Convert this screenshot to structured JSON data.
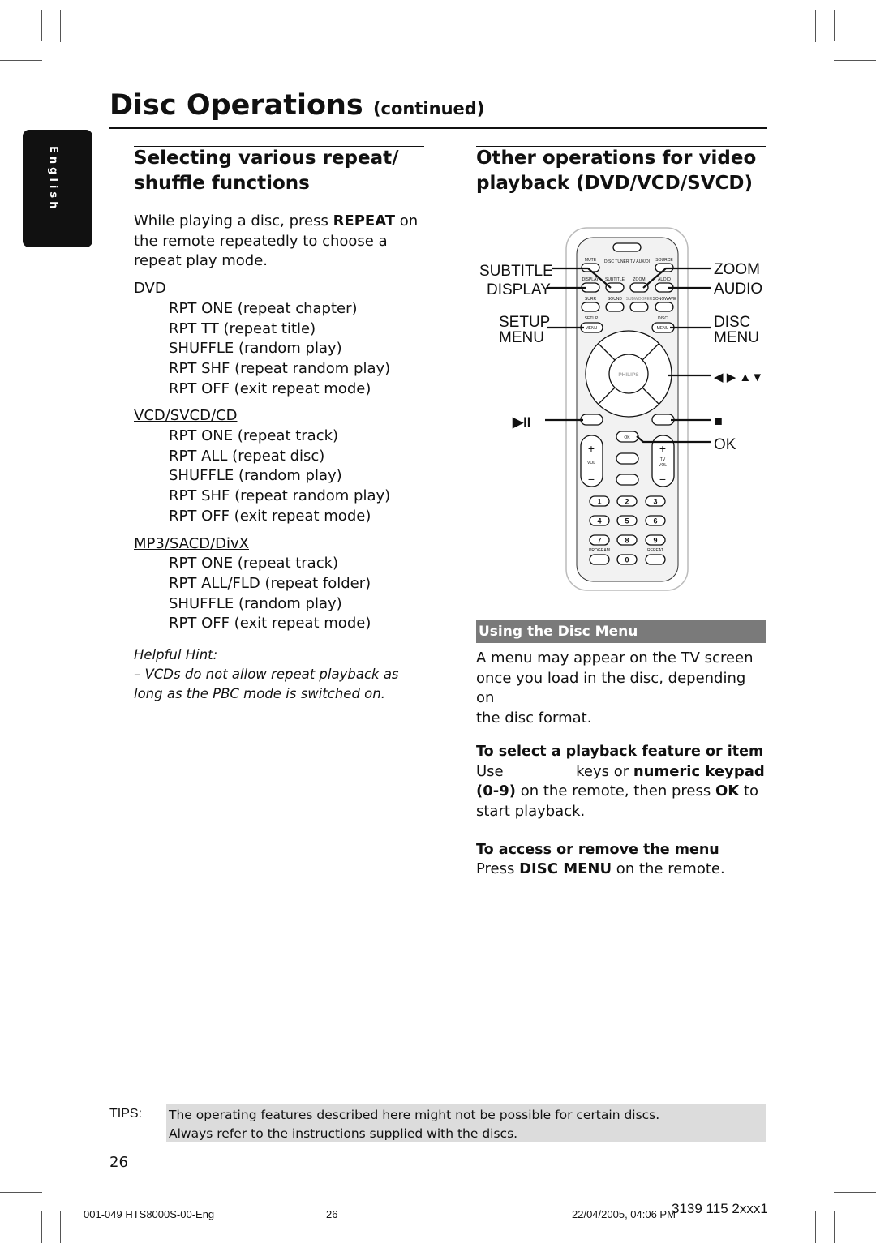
{
  "header": {
    "title": "Disc Operations",
    "title_suffix": "(continued)",
    "language_tab": "English"
  },
  "left": {
    "heading": [
      "Selecting various repeat/",
      "shuffle functions"
    ],
    "intro": [
      "While playing a disc, press ",
      "REPEAT",
      " on the remote repeatedly to choose a repeat play mode."
    ],
    "groups": [
      {
        "name": "DVD",
        "items": [
          "RPT ONE (repeat chapter)",
          "RPT  TT (repeat title)",
          "SHUFFLE (random play)",
          "RPT SHF (repeat random play)",
          "RPT OFF (exit repeat mode)"
        ]
      },
      {
        "name": "VCD/SVCD/CD",
        "items": [
          "RPT ONE (repeat track)",
          "RPT ALL (repeat disc)",
          "SHUFFLE (random play)",
          "RPT SHF (repeat random play)",
          "RPT OFF (exit repeat mode)"
        ]
      },
      {
        "name": "MP3/SACD/DivX",
        "items": [
          "RPT ONE (repeat track)",
          "RPT ALL/FLD (repeat folder)",
          "SHUFFLE (random play)",
          "RPT OFF (exit repeat mode)"
        ]
      }
    ],
    "hint_title": "Helpful Hint:",
    "hint_lines": [
      "– VCDs do not allow repeat playback as",
      "long as the PBC mode is switched on."
    ]
  },
  "right": {
    "heading": [
      "Other operations for video",
      "playback (DVD/VCD/SVCD)"
    ],
    "remote": {
      "callouts_left": [
        "SUBTITLE",
        "DISPLAY",
        "SETUP",
        "MENU"
      ],
      "callouts_right": [
        "ZOOM",
        "AUDIO",
        "DISC",
        "MENU",
        "◀ ▶ ▲▼",
        "■",
        "OK"
      ],
      "play_pause": "▶II",
      "brand": "PHILIPS",
      "key_labels": {
        "mute": "MUTE",
        "source": "SOURCE",
        "sources": "DISC TUNER TV AUX/DI",
        "display": "DISPLAY",
        "subtitle": "SUBTITLE",
        "zoom": "ZOOM",
        "audio": "AUDIO",
        "surr": "SURR",
        "sound": "SOUND",
        "subwoofer": "SUBWOOFER",
        "sonowave": "SONOWAVE",
        "setup": "SETUP",
        "disc": "DISC",
        "menu": "MENU",
        "ok": "OK",
        "vol": "VOL",
        "tv": "TV",
        "program": "PROGRAM",
        "repeat": "REPEAT",
        "digits": [
          "1",
          "2",
          "3",
          "4",
          "5",
          "6",
          "7",
          "8",
          "9",
          "0"
        ]
      }
    },
    "section_bar": "Using the Disc Menu",
    "para": [
      "A menu may appear on the TV screen",
      "once you load in the disc, depending on",
      "the disc format."
    ],
    "sub1": "To select a playback feature or item",
    "sub1_text": {
      "a": "Use ",
      "b": " keys or ",
      "c": "numeric keypad",
      "d": "(0-9)",
      "e": " on the remote, then press ",
      "f": "OK",
      "g": " to",
      "h": "start playback."
    },
    "sub2": "To access or remove the menu",
    "sub2_text": {
      "a": "Press ",
      "b": "DISC MENU",
      "c": " on the remote."
    }
  },
  "tips": {
    "label": "TIPS:",
    "lines": [
      "The operating features described here might not be possible for certain discs.",
      "Always refer to the instructions supplied with the discs."
    ]
  },
  "page_number": "26",
  "footer": {
    "file": "001-049 HTS8000S-00-Eng",
    "page": "26",
    "date": "22/04/2005, 04:06 PM",
    "code": "3139 115 2xxx1"
  }
}
